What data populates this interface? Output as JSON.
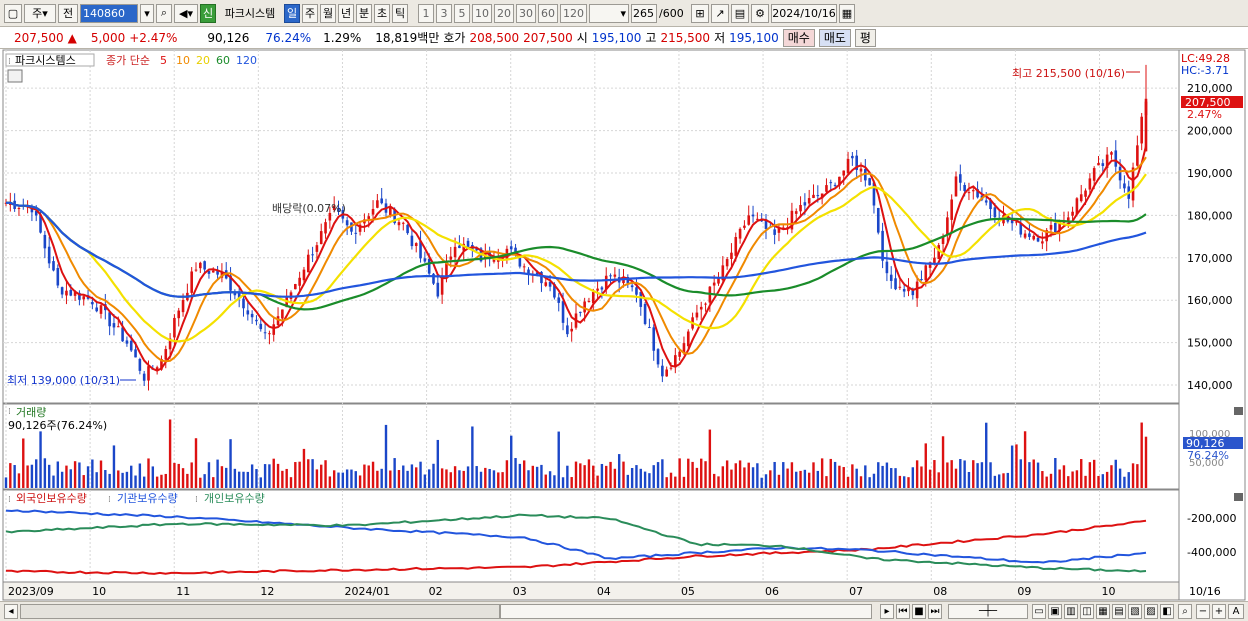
{
  "toolbar": {
    "market": "주",
    "prev": "전",
    "code": "140860",
    "new_badge": "신",
    "stock_name": "파크시스템",
    "periods": [
      "일",
      "주",
      "월",
      "년",
      "분",
      "초",
      "틱"
    ],
    "active_period": "일",
    "intervals": [
      "1",
      "3",
      "5",
      "10",
      "20",
      "30",
      "60",
      "120"
    ],
    "count": "265",
    "count_total": "/600",
    "date": "2024/10/16"
  },
  "info": {
    "price": "207,500",
    "change": "5,000",
    "change_pct": "+2.47%",
    "volume": "90,126",
    "volume_ratio": "76.24%",
    "turnover": "1.29%",
    "amount": "18,819백만",
    "quote_label": "호가",
    "quote_ask": "208,500",
    "quote_bid": "207,500",
    "open_label": "시",
    "open": "195,100",
    "high_label": "고",
    "high": "215,500",
    "low_label": "저",
    "low": "195,100",
    "buy": "매수",
    "sell": "매도",
    "avg": "평"
  },
  "price_panel": {
    "title": "파크시스템스",
    "ma_title": "종가 단순",
    "ma_periods": [
      "5",
      "10",
      "20",
      "60",
      "120"
    ],
    "ma_colors": [
      "#dd1111",
      "#f08a00",
      "#f4e100",
      "#1a8c2a",
      "#2255dd"
    ],
    "lc": "LC:49.28",
    "hc": "HC:-3.71",
    "last_price": "207,500",
    "last_pct": "2.47%",
    "max_label": "최고 215,500 (10/16)",
    "min_label": "최저 139,000 (10/31)",
    "dividend_label": "배당락(0.07%)",
    "y_ticks": [
      "210,000",
      "200,000",
      "190,000",
      "180,000",
      "170,000",
      "160,000",
      "150,000",
      "140,000"
    ],
    "y_values": [
      210000,
      200000,
      190000,
      180000,
      170000,
      160000,
      150000,
      140000
    ]
  },
  "volume_panel": {
    "title": "거래량",
    "value": "90,126주(76.24%)",
    "last": "90,126",
    "last_pct": "76.24%",
    "y_ticks": [
      "100,000",
      "50,000"
    ]
  },
  "holdings_panel": {
    "series_names": [
      "외국인보유수량",
      "기관보유수량",
      "개인보유수량"
    ],
    "y_ticks": [
      "-200,000",
      "-400,000"
    ]
  },
  "x_axis": {
    "labels": [
      "2023/09",
      "10",
      "11",
      "12",
      "2024/01",
      "02",
      "03",
      "04",
      "05",
      "06",
      "07",
      "08",
      "09",
      "10"
    ],
    "end_label": "10/16"
  },
  "chart_data": [
    {
      "type": "candlestick",
      "title": "파크시스템스",
      "ylim": [
        136000,
        219000
      ],
      "series": [
        {
          "name": "5"
        },
        {
          "name": "10"
        },
        {
          "name": "20"
        },
        {
          "name": "60"
        },
        {
          "name": "120"
        }
      ],
      "x": [
        "2023/09",
        "10",
        "11",
        "12",
        "2024/01",
        "02",
        "03",
        "04",
        "05",
        "06",
        "07",
        "08",
        "09",
        "10"
      ],
      "close_path": [
        [
          0,
          183000
        ],
        [
          0.3,
          182000
        ],
        [
          0.6,
          163000
        ],
        [
          1,
          160000
        ],
        [
          1.4,
          150000
        ],
        [
          1.6,
          142000
        ],
        [
          1.8,
          146000
        ],
        [
          2,
          158000
        ],
        [
          2.2,
          168000
        ],
        [
          2.5,
          166000
        ],
        [
          2.8,
          158000
        ],
        [
          3,
          151000
        ],
        [
          3.2,
          158000
        ],
        [
          3.5,
          170000
        ],
        [
          3.8,
          181000
        ],
        [
          4,
          176000
        ],
        [
          4.3,
          183000
        ],
        [
          4.6,
          178000
        ],
        [
          5,
          162000
        ],
        [
          5.2,
          174000
        ],
        [
          5.5,
          170000
        ],
        [
          5.8,
          172000
        ],
        [
          6,
          168000
        ],
        [
          6.3,
          164000
        ],
        [
          6.5,
          153000
        ],
        [
          6.7,
          160000
        ],
        [
          7,
          166000
        ],
        [
          7.3,
          162000
        ],
        [
          7.6,
          143000
        ],
        [
          7.8,
          148000
        ],
        [
          8,
          157000
        ],
        [
          8.3,
          167000
        ],
        [
          8.6,
          180000
        ],
        [
          8.9,
          175000
        ],
        [
          9.2,
          182000
        ],
        [
          9.5,
          186000
        ],
        [
          9.8,
          193000
        ],
        [
          10,
          188000
        ],
        [
          10.2,
          165000
        ],
        [
          10.5,
          162000
        ],
        [
          10.8,
          172000
        ],
        [
          11,
          188000
        ],
        [
          11.2,
          186000
        ],
        [
          11.5,
          180000
        ],
        [
          11.8,
          176000
        ],
        [
          12,
          175000
        ],
        [
          12.3,
          180000
        ],
        [
          12.6,
          190000
        ],
        [
          12.8,
          194000
        ],
        [
          13,
          185000
        ],
        [
          13.2,
          207500
        ]
      ],
      "high": 215500,
      "low": 139000
    },
    {
      "type": "bar",
      "title": "거래량",
      "ylim": [
        0,
        130000
      ],
      "last": 90126
    },
    {
      "type": "line",
      "title": "",
      "series": [
        {
          "name": "외국인보유수량",
          "color": "#dd1111"
        },
        {
          "name": "기관보유수량",
          "color": "#2255dd"
        },
        {
          "name": "개인보유수량",
          "color": "#2a8c5a"
        }
      ],
      "ylim": [
        -520000,
        -80000
      ]
    }
  ],
  "bottom": {
    "zoom_out": "−",
    "zoom_in": "+",
    "auto": "A"
  }
}
